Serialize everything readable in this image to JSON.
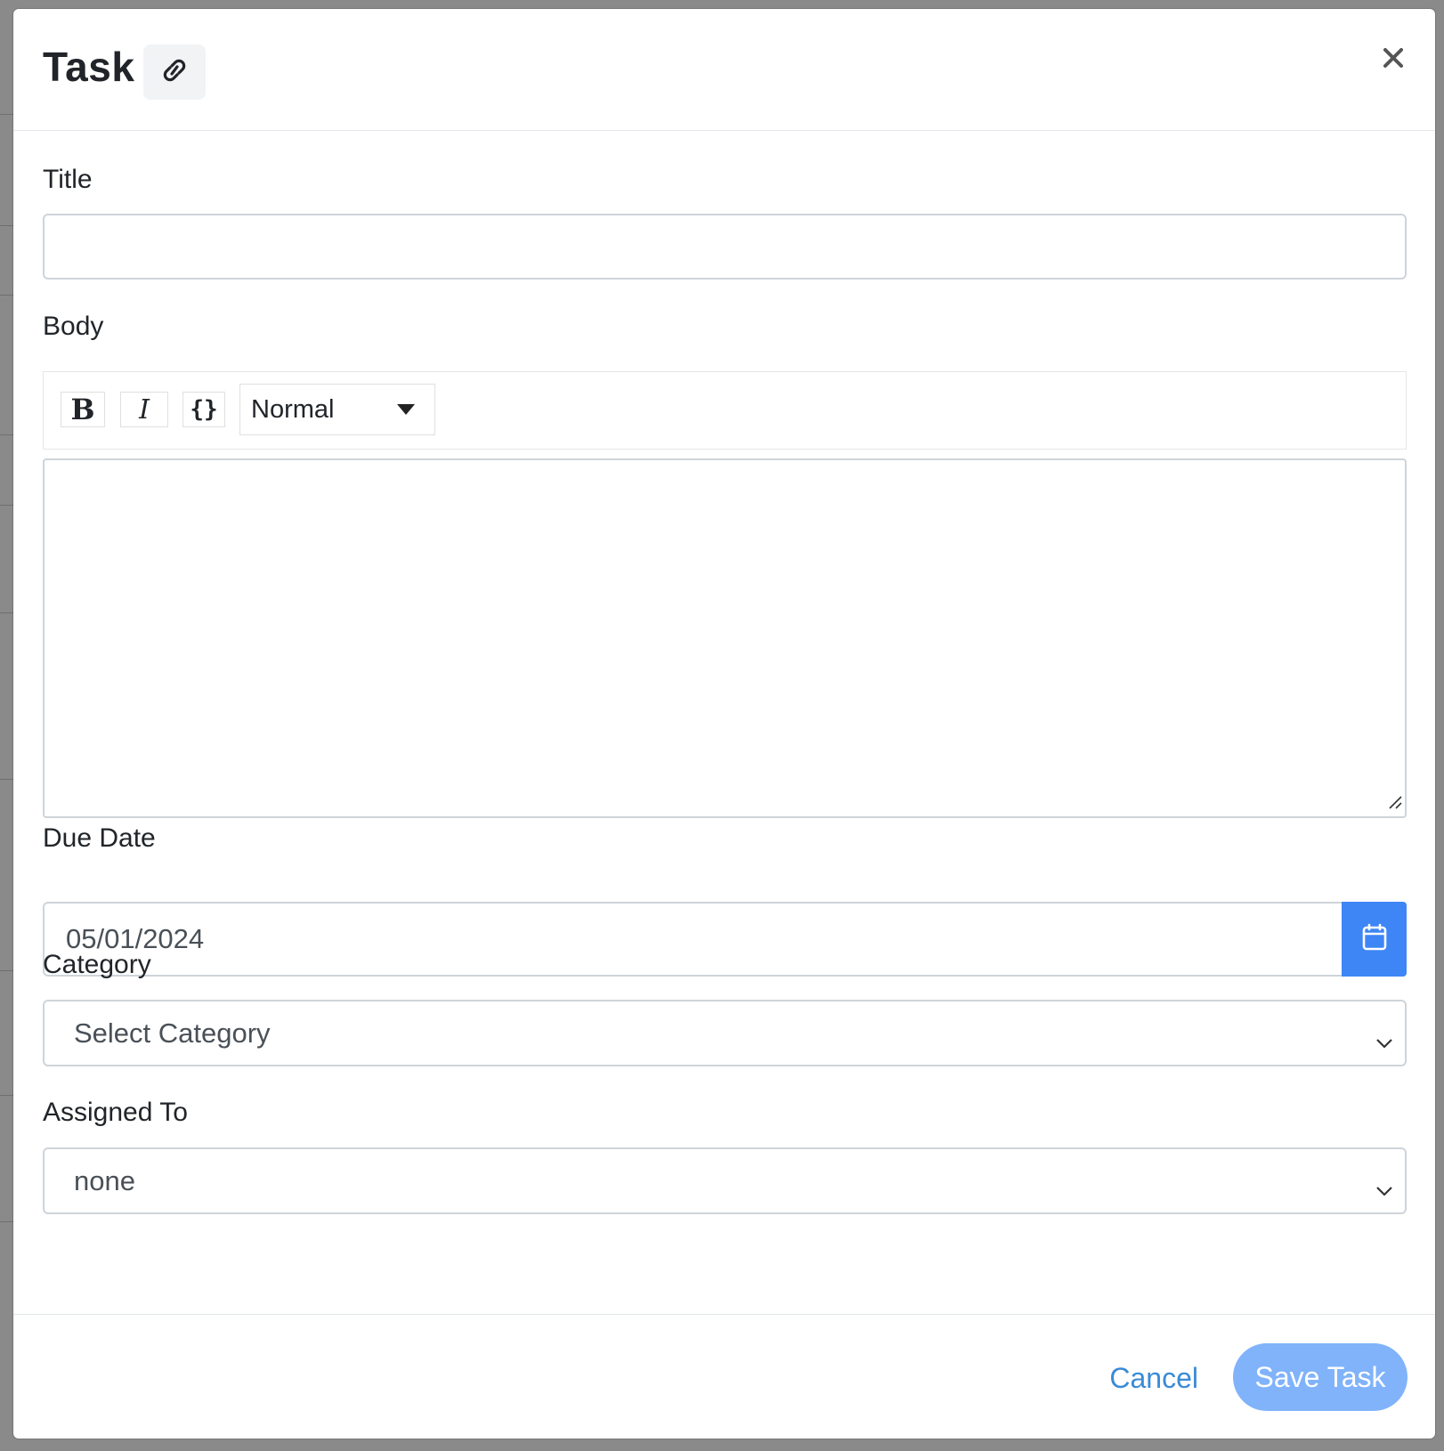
{
  "modal": {
    "title": "Task"
  },
  "form": {
    "title_label": "Title",
    "title_value": "",
    "body_label": "Body",
    "toolbar": {
      "bold_label": "B",
      "italic_label": "I",
      "code_label": "{}",
      "format_selected": "Normal"
    },
    "due_date_label": "Due Date",
    "due_date_value": "05/01/2024",
    "category_label": "Category",
    "category_selected": "Select Category",
    "assigned_label": "Assigned To",
    "assigned_selected": "none"
  },
  "footer": {
    "cancel_label": "Cancel",
    "save_label": "Save Task"
  },
  "colors": {
    "primary": "#3e86f5",
    "save_disabled": "#80b3fa",
    "link": "#3a8bd6"
  },
  "icons": {
    "header_link": "link-icon",
    "close": "close-icon",
    "calendar": "calendar-icon",
    "dropdown": "chevron-down-icon"
  }
}
